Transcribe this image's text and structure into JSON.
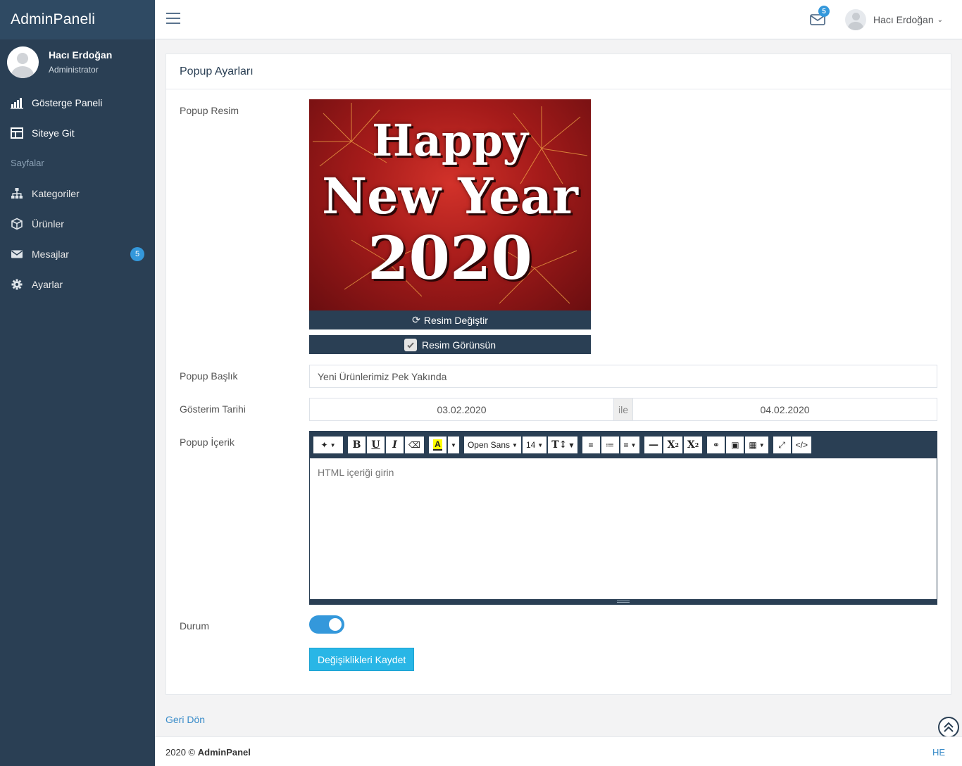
{
  "app": {
    "brand": "AdminPaneli"
  },
  "sidebar": {
    "user": {
      "name": "Hacı Erdoğan",
      "role": "Administrator"
    },
    "items": [
      {
        "label": "Gösterge Paneli",
        "icon": "bar-chart-icon"
      },
      {
        "label": "Siteye Git",
        "icon": "layout-icon"
      }
    ],
    "section_label": "Sayfalar",
    "pages": [
      {
        "label": "Kategoriler",
        "icon": "sitemap-icon"
      },
      {
        "label": "Ürünler",
        "icon": "cube-icon"
      },
      {
        "label": "Mesajlar",
        "icon": "envelope-icon",
        "badge": "5"
      },
      {
        "label": "Ayarlar",
        "icon": "gear-icon"
      }
    ]
  },
  "topnav": {
    "mail_count": "5",
    "user_name": "Hacı Erdoğan"
  },
  "panel": {
    "title": "Popup Ayarları",
    "labels": {
      "image": "Popup Resim",
      "title": "Popup Başlık",
      "date": "Gösterim Tarihi",
      "content": "Popup İçerik",
      "status": "Durum"
    },
    "image": {
      "line1": "Happy",
      "line2": "New Year",
      "line3": "2020",
      "change_button": "Resim Değiştir",
      "visible_checkbox": "Resim Görünsün",
      "visible_checked": true
    },
    "title_value": "Yeni Ürünlerimiz Pek Yakında",
    "date_start": "03.02.2020",
    "date_sep": "ile",
    "date_end": "04.02.2020",
    "editor": {
      "font_family": "Open Sans",
      "font_size": "14",
      "placeholder": "HTML içeriği girin"
    },
    "status_on": true,
    "save_button": "Değişiklikleri Kaydet"
  },
  "back_link": "Geri Dön",
  "footer": {
    "year": "2020 ©",
    "brand": "AdminPanel",
    "right": "HE"
  },
  "colors": {
    "sidebar": "#2a3f54",
    "accent": "#3498db",
    "save": "#29b6e6"
  }
}
